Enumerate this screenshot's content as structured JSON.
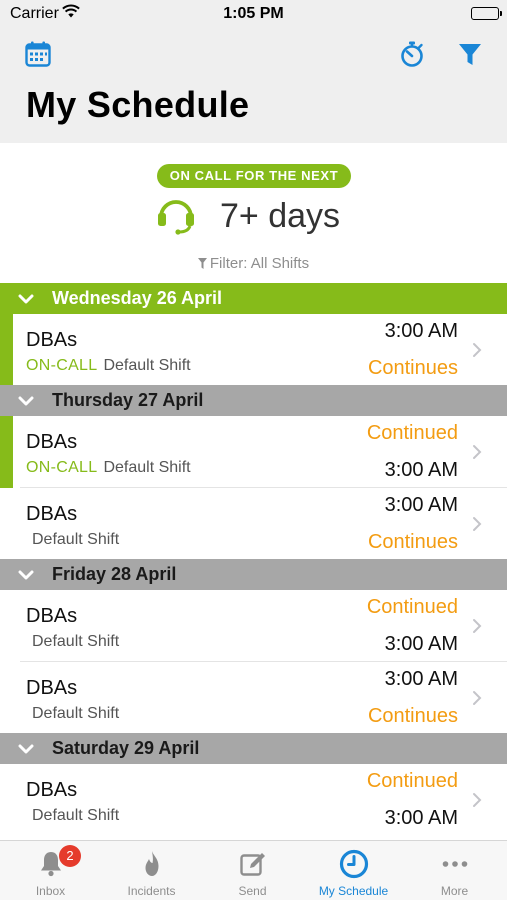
{
  "status_bar": {
    "carrier": "Carrier",
    "time": "1:05 PM"
  },
  "nav": {
    "title": "My Schedule",
    "left_icon": "calendar-icon",
    "right_icons": [
      "stopwatch-icon",
      "filter-icon"
    ]
  },
  "oncall": {
    "pill": "ON CALL FOR THE NEXT",
    "value": "7+ days",
    "filter_text": "Filter: All Shifts"
  },
  "days": [
    {
      "label": "Wednesday 26 April",
      "style": "green",
      "shifts": [
        {
          "team": "DBAs",
          "oncall": "ON-CALL",
          "shift": "Default Shift",
          "top": "3:00 AM",
          "bottom": "Continues"
        }
      ]
    },
    {
      "label": "Thursday 27 April",
      "style": "gray",
      "shifts": [
        {
          "team": "DBAs",
          "oncall": "ON-CALL",
          "shift": "Default Shift",
          "top": "Continued",
          "bottom": "3:00 AM"
        },
        {
          "team": "DBAs",
          "oncall": "",
          "shift": "Default Shift",
          "top": "3:00 AM",
          "bottom": "Continues"
        }
      ]
    },
    {
      "label": "Friday 28 April",
      "style": "gray",
      "shifts": [
        {
          "team": "DBAs",
          "oncall": "",
          "shift": "Default Shift",
          "top": "Continued",
          "bottom": "3:00 AM"
        },
        {
          "team": "DBAs",
          "oncall": "",
          "shift": "Default Shift",
          "top": "3:00 AM",
          "bottom": "Continues"
        }
      ]
    },
    {
      "label": "Saturday 29 April",
      "style": "gray",
      "shifts": [
        {
          "team": "DBAs",
          "oncall": "",
          "shift": "Default Shift",
          "top": "Continued",
          "bottom": "3:00 AM"
        }
      ]
    }
  ],
  "tabs": [
    {
      "label": "Inbox",
      "icon": "bell-icon",
      "badge": "2",
      "active": false
    },
    {
      "label": "Incidents",
      "icon": "flame-icon",
      "active": false
    },
    {
      "label": "Send",
      "icon": "compose-icon",
      "active": false
    },
    {
      "label": "My Schedule",
      "icon": "clock-icon",
      "active": true
    },
    {
      "label": "More",
      "icon": "ellipsis-icon",
      "active": false
    }
  ],
  "colors": {
    "accent_green": "#86bb1a",
    "orange": "#f39c12",
    "blue": "#1a86d6",
    "badge_red": "#e53b2c"
  }
}
